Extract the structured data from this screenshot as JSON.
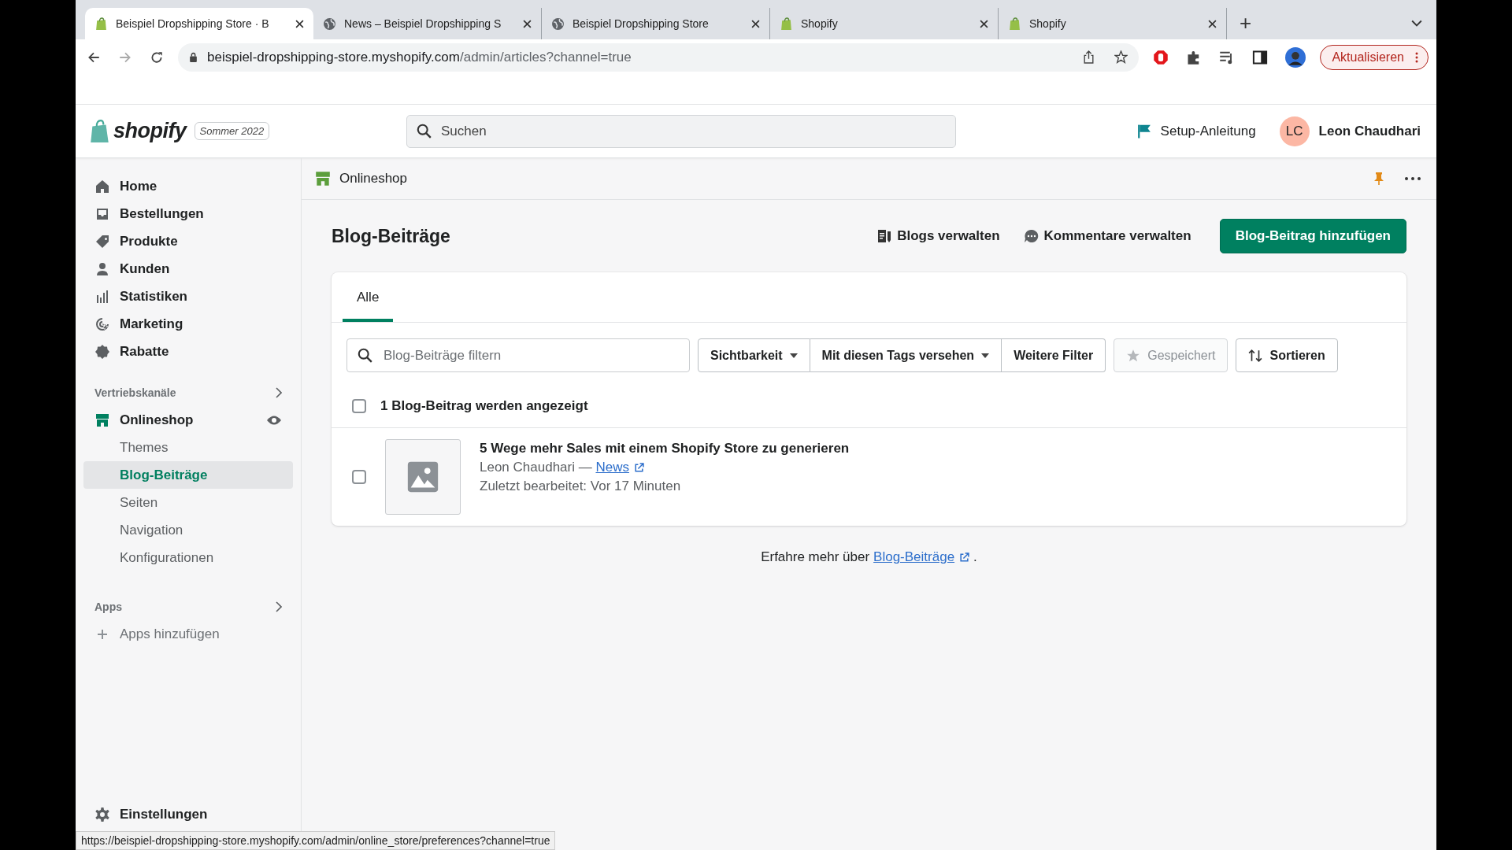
{
  "browser": {
    "tabs": [
      {
        "title": "Beispiel Dropshipping Store · B",
        "kind": "shop",
        "selected": true
      },
      {
        "title": "News – Beispiel Dropshipping S",
        "kind": "web",
        "selected": false
      },
      {
        "title": "Beispiel Dropshipping Store",
        "kind": "web",
        "selected": false
      },
      {
        "title": "Shopify",
        "kind": "shop",
        "selected": false
      },
      {
        "title": "Shopify",
        "kind": "shop",
        "selected": false
      }
    ],
    "new_tab": "+",
    "address": {
      "host": "beispiel-dropshipping-store.myshopify.com",
      "path": "/admin/articles?channel=true"
    },
    "update_button": "Aktualisieren"
  },
  "header": {
    "logo": "shopify",
    "edition": "Sommer 2022",
    "search": {
      "placeholder": "Suchen"
    },
    "setup": "Setup-Anleitung",
    "user": {
      "initials": "LC",
      "name": "Leon Chaudhari"
    }
  },
  "sidebar": {
    "items": [
      {
        "label": "Home"
      },
      {
        "label": "Bestellungen"
      },
      {
        "label": "Produkte"
      },
      {
        "label": "Kunden"
      },
      {
        "label": "Statistiken"
      },
      {
        "label": "Marketing"
      },
      {
        "label": "Rabatte"
      }
    ],
    "sales_channels": {
      "heading": "Vertriebskanäle",
      "channel": {
        "label": "Onlineshop",
        "children": [
          {
            "label": "Themes",
            "selected": false
          },
          {
            "label": "Blog-Beiträge",
            "selected": true
          },
          {
            "label": "Seiten",
            "selected": false
          },
          {
            "label": "Navigation",
            "selected": false
          },
          {
            "label": "Konfigurationen",
            "selected": false
          }
        ]
      }
    },
    "apps": {
      "heading": "Apps",
      "add": "Apps hinzufügen"
    },
    "settings": "Einstellungen"
  },
  "channel_bar": {
    "title": "Onlineshop"
  },
  "page": {
    "title": "Blog-Beiträge",
    "actions": [
      "Blogs verwalten",
      "Kommentare verwalten"
    ],
    "primary_button": "Blog-Beitrag hinzufügen",
    "tabs": [
      {
        "label": "Alle",
        "selected": true
      }
    ],
    "filter": {
      "placeholder": "Blog-Beiträge filtern"
    },
    "filter_buttons": [
      {
        "label": "Sichtbarkeit",
        "kind": "dropdown",
        "disabled": false
      },
      {
        "label": "Mit diesen Tags versehen",
        "kind": "dropdown",
        "disabled": false
      },
      {
        "label": "Weitere Filter",
        "kind": "plain",
        "disabled": false
      },
      {
        "label": "Gespeichert",
        "kind": "saved",
        "disabled": true
      },
      {
        "label": "Sortieren",
        "kind": "sort",
        "disabled": false
      }
    ],
    "count": {
      "text": "1 Blog-Beitrag werden angezeigt",
      "checked": false
    },
    "articles": [
      {
        "title": "5 Wege mehr Sales mit einem Shopify Store zu generieren",
        "author": "Leon Chaudhari —",
        "blog": "News",
        "edited": "Zuletzt bearbeitet: Vor 17 Minuten",
        "checked": false
      }
    ],
    "footer": {
      "prefix": "Erfahre mehr über",
      "link": "Blog-Beiträge",
      "suffix": "."
    }
  },
  "status_url": "https://beispiel-dropshipping-store.myshopify.com/admin/online_store/preferences?channel=true"
}
